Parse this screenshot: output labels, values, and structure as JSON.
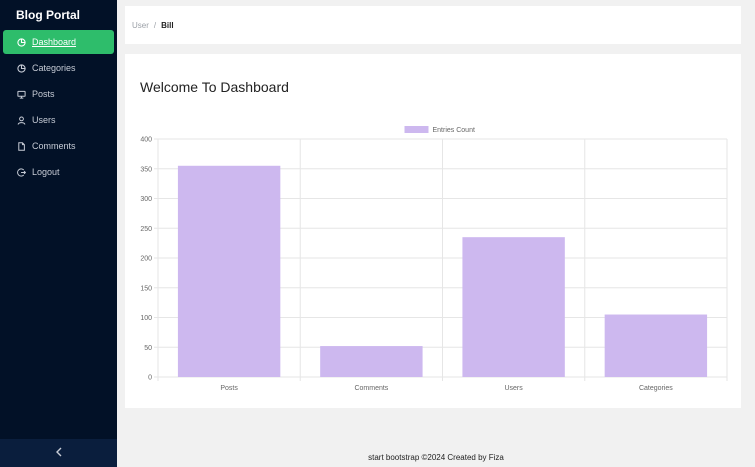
{
  "sidebar": {
    "brand": "Blog Portal",
    "items": [
      {
        "label": "Dashboard",
        "icon": "pie-chart-icon",
        "active": true
      },
      {
        "label": "Categories",
        "icon": "pie-chart-icon",
        "active": false
      },
      {
        "label": "Posts",
        "icon": "monitor-icon",
        "active": false
      },
      {
        "label": "Users",
        "icon": "user-icon",
        "active": false
      },
      {
        "label": "Comments",
        "icon": "document-icon",
        "active": false
      },
      {
        "label": "Logout",
        "icon": "logout-icon",
        "active": false
      }
    ],
    "collapse_icon": "chevron-left-icon"
  },
  "breadcrumb": {
    "parent": "User",
    "separator": "/",
    "current": "Bill"
  },
  "page": {
    "title": "Welcome To Dashboard"
  },
  "chart_data": {
    "type": "bar",
    "categories": [
      "Posts",
      "Comments",
      "Users",
      "Categories"
    ],
    "series": [
      {
        "name": "Entries Count",
        "values": [
          355,
          52,
          235,
          105
        ],
        "color": "#cdb8ef"
      }
    ],
    "ylim": [
      0,
      400
    ],
    "yticks": [
      0,
      50,
      100,
      150,
      200,
      250,
      300,
      350,
      400
    ],
    "grid": true,
    "legend": "top-center"
  },
  "footer": {
    "text": "start bootstrap ©2024 Created by Fiza"
  },
  "colors": {
    "sidebar_bg": "#021127",
    "active_item": "#2ebd6b",
    "bar_fill": "#cdb8ef"
  }
}
